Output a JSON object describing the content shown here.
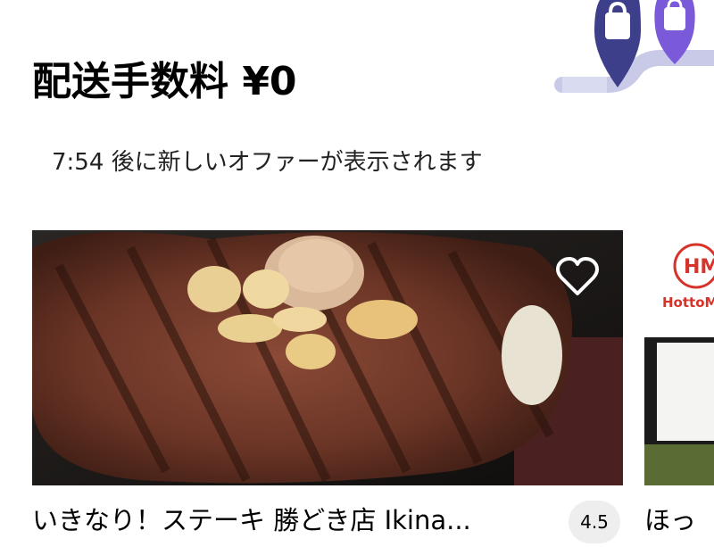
{
  "offer": {
    "title": "配送手数料 ¥0",
    "countdown_text": "7:54 後に新しいオファーが表示されます"
  },
  "cards": [
    {
      "name": "いきなり！ステーキ 勝どき店 Ikina...",
      "rating": "4.5",
      "favorite_icon": "heart-outline-icon"
    },
    {
      "name": "ほっ",
      "logo_text": "HM",
      "logo_caption": "HottoM"
    }
  ],
  "colors": {
    "accent_pin_dark": "#3d3f8a",
    "accent_pin_light": "#7a5ad8",
    "route": "#c7c9e6",
    "rating_bg": "#eeeeee"
  }
}
